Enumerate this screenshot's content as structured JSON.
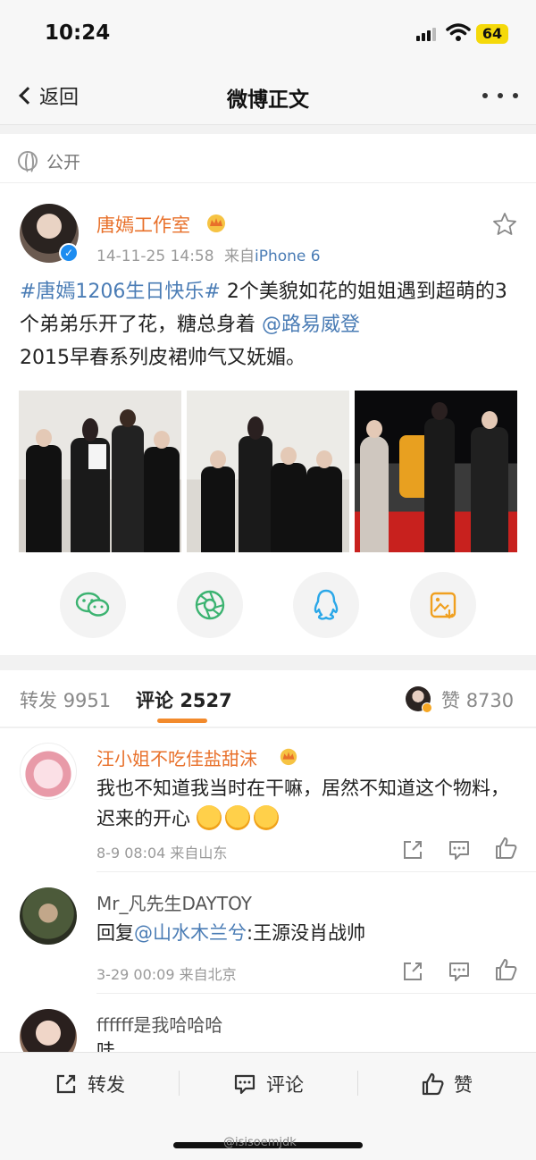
{
  "status_bar": {
    "time": "10:24",
    "battery": "64"
  },
  "nav": {
    "back_label": "返回",
    "title": "微博正文"
  },
  "post": {
    "visibility": "公开",
    "author": "唐嫣工作室",
    "timestamp": "14-11-25 14:58",
    "source_prefix": "来自",
    "source": "iPhone 6",
    "text": {
      "hashtag": "#唐嫣1206生日快乐#",
      "part1": " 2个美貌如花的姐姐遇到超萌的3个弟弟乐开了花，糖总身着",
      "mention": "@路易威登",
      "part2": "2015早春系列皮裙帅气又妩媚。"
    },
    "share_icons": [
      "wechat-icon",
      "moments-icon",
      "qq-icon",
      "save-image-icon"
    ]
  },
  "tabs": {
    "repost_label": "转发",
    "repost_count": "9951",
    "comment_label": "评论",
    "comment_count": "2527",
    "like_label": "赞",
    "like_count": "8730"
  },
  "comments": [
    {
      "name": "汪小姐不吃佳盐甜沫",
      "text": "我也不知道我当时在干嘛，居然不知道这个物料，迟来的开心",
      "meta": "8-9 08:04 来自山东"
    },
    {
      "name": "Mr_凡先生DAYTOY",
      "reply_prefix": "回复",
      "mention": "@山水木兰兮",
      "text": ":王源没肖战帅",
      "meta": "3-29 00:09 来自北京"
    },
    {
      "name": "ffffff是我哈哈哈",
      "text": "哇"
    }
  ],
  "bottom_bar": {
    "repost": "转发",
    "comment": "评论",
    "like": "赞"
  },
  "watermark": "@isisoemjdk",
  "colors": {
    "accent": "#f28a2c",
    "link": "#4a7cb5",
    "vip_name": "#e8702a"
  }
}
